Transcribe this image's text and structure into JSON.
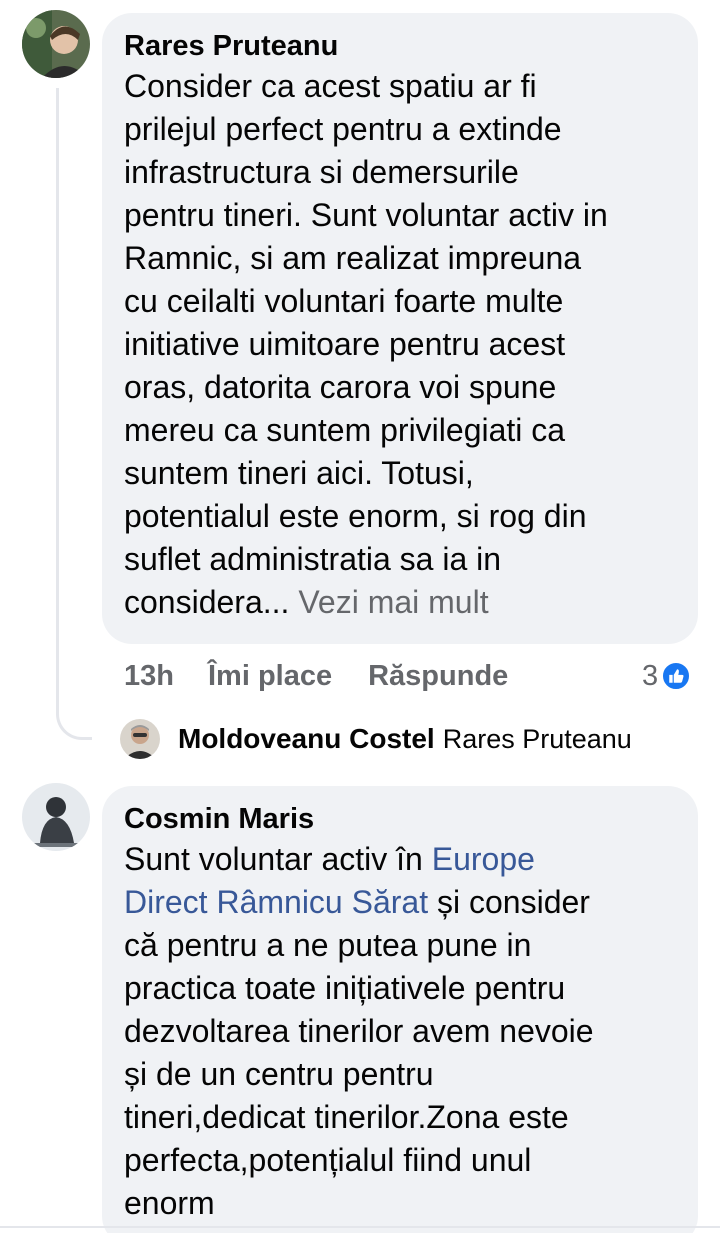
{
  "comment1": {
    "author": "Rares Pruteanu",
    "text": "Consider ca acest spatiu ar fi\nprilejul perfect pentru a extinde\ninfrastructura si demersurile\npentru tineri. Sunt voluntar activ in\nRamnic, si am realizat impreuna\ncu ceilalti voluntari foarte multe\ninitiative uimitoare pentru acest\noras, datorita carora voi spune\nmereu ca suntem privilegiati ca\nsuntem tineri aici. Totusi,\npotentialul este enorm, si rog din\nsuflet administratia sa ia in\nconsidera... ",
    "see_more": "Vezi mai mult",
    "time": "13h",
    "like_label": "Îmi place",
    "reply_label": "Răspunde",
    "reaction_count": "3"
  },
  "reply_preview": {
    "author": "Moldoveanu Costel",
    "replying_to": "Rares Pruteanu"
  },
  "comment2": {
    "author": "Cosmin Maris",
    "text_before": "Sunt voluntar activ în ",
    "link_text": "Europe\nDirect Râmnicu Sărat",
    "text_after": "  și consider\ncă pentru a ne putea pune in\npractica toate inițiativele pentru\ndezvoltarea tinerilor avem nevoie\nși de un centru pentru\ntineri,dedicat tinerilor.Zona este\nperfecta,potențialul fiind unul\nenorm"
  },
  "colors": {
    "bubble": "#f0f2f5",
    "link": "#385898",
    "muted": "#65676b",
    "like_blue": "#1877f2"
  },
  "icons": [
    "avatar-rares",
    "avatar-moldoveanu",
    "avatar-cosmin",
    "like-thumb-icon"
  ]
}
